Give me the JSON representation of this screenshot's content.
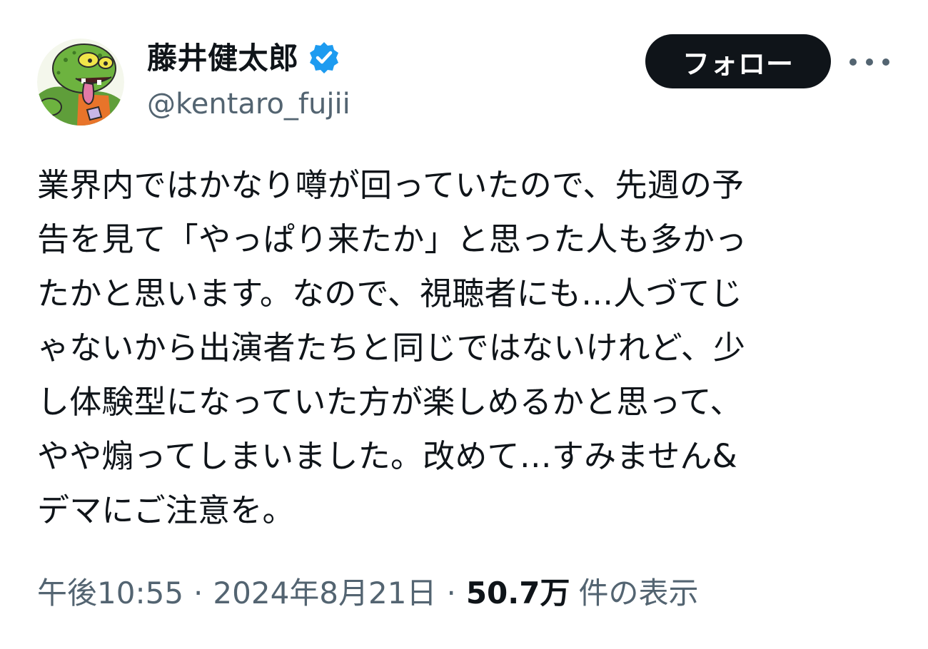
{
  "author": {
    "display_name": "藤井健太郎",
    "handle": "@kentaro_fujii",
    "verified": true
  },
  "actions": {
    "follow_label": "フォロー"
  },
  "tweet": {
    "lines": [
      "業界内ではかなり噂が回っていたので、先週の予",
      "告を見て「やっぱり来たか」と思った人も多かっ",
      "たかと思います。なので、視聴者にも…人づてじ",
      "ゃないから出演者たちと同じではないけれど、少",
      "し体験型になっていた方が楽しめるかと思って、",
      "やや煽ってしまいました。改めて…すみません&",
      "デマにご注意を。"
    ]
  },
  "meta": {
    "time": "午後10:55",
    "separator": "·",
    "date": "2024年8月21日",
    "views_count": "50.7万",
    "views_label": "件の表示"
  },
  "colors": {
    "text_primary": "#0f1419",
    "text_secondary": "#536471",
    "verified_blue": "#1d9bf0",
    "follow_bg": "#0f1419"
  },
  "icons": {
    "verified": "verified-badge-icon",
    "more": "more-horizontal-icon"
  }
}
